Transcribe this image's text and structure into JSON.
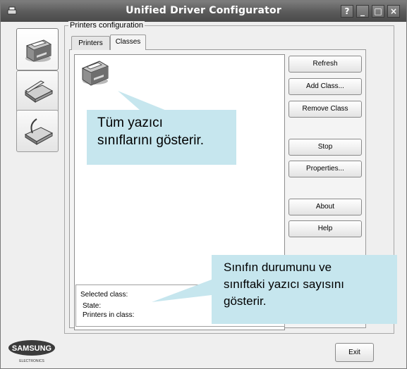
{
  "window": {
    "title": "Unified Driver Configurator"
  },
  "titlebar_buttons": {
    "help": "?",
    "minimize": "_",
    "maximize": "□",
    "close": "×"
  },
  "group": {
    "label": "Printers configuration"
  },
  "tabs": [
    {
      "label": "Printers"
    },
    {
      "label": "Classes"
    }
  ],
  "buttons": {
    "refresh": "Refresh",
    "add_class": "Add Class...",
    "remove_class": "Remove Class",
    "stop": "Stop",
    "properties": "Properties...",
    "about": "About",
    "help": "Help",
    "exit": "Exit"
  },
  "selected_class": {
    "label": "Selected class:",
    "state_label": "State:",
    "printers_label": "Printers in class:"
  },
  "callouts": {
    "classes_line1": "Tüm yazıcı",
    "classes_line2": "sınıflarını gösterir.",
    "state_line1": "Sınıfın durumunu ve",
    "state_line2": "sınıftaki yazıcı sayısını",
    "state_line3": "gösterir."
  },
  "brand": {
    "name": "SAMSUNG",
    "sub": "ELECTRONICS"
  }
}
